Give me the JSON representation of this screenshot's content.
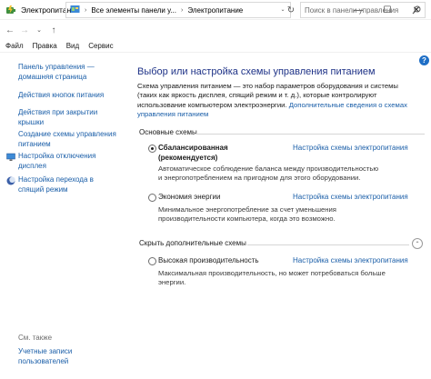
{
  "window": {
    "title": "Электропитание",
    "minimize": "—",
    "maximize": "☐",
    "close": "✕"
  },
  "address": {
    "back": "←",
    "forward": "→",
    "recent": "⌄",
    "up": "↑",
    "crumb_root": "›",
    "crumb_1": "Все элементы панели у...",
    "crumb_sep": "›",
    "crumb_2": "Электропитание",
    "dropdown": "⌄",
    "refresh": "↻",
    "search_placeholder": "Поиск в панели управления"
  },
  "menu": {
    "file": "Файл",
    "edit": "Правка",
    "view": "Вид",
    "service": "Сервис"
  },
  "help": "?",
  "sidebar": {
    "home_line1": "Панель управления —",
    "home_line2": "домашняя страница",
    "power_buttons": "Действия кнопок питания",
    "lid_line1": "Действия при закрытии",
    "lid_line2": "крышки",
    "create_line1": "Создание схемы управления",
    "create_line2": "питанием",
    "display_line1": "Настройка отключения",
    "display_line2": "дисплея",
    "sleep_line1": "Настройка перехода в",
    "sleep_line2": "спящий режим",
    "see_also": "См. также",
    "accounts_line1": "Учетные записи",
    "accounts_line2": "пользователей"
  },
  "main": {
    "heading": "Выбор или настройка схемы управления питанием",
    "intro_line1": "Схема управления питанием — это набор параметров оборудования и системы",
    "intro_line2": "(таких как яркость дисплея, спящий режим и т. д.), которые контролируют",
    "intro_line3a": "использование компьютером электроэнергии.",
    "intro_link_a": "Дополнительные сведения о схемах",
    "intro_link_b": "управления питанием",
    "main_plans_title": "Основные схемы",
    "balanced_line1": "Сбалансированная",
    "balanced_line2": "(рекомендуется)",
    "balanced_desc_line1": "Автоматическое соблюдение баланса между производительностью",
    "balanced_desc_line2": "и энергопотреблением на пригодном для этого оборудовании.",
    "saver_name": "Экономия энергии",
    "saver_desc_line1": "Минимальное энергопотребление за счет уменьшения",
    "saver_desc_line2": "производительности компьютера, когда это возможно.",
    "hide_title": "Скрыть дополнительные схемы",
    "collapse": "⌃",
    "high_name": "Высокая производительность",
    "high_desc_line1": "Максимальная производительность, но может потребоваться больше",
    "high_desc_line2": "энергии.",
    "plan_settings_link": "Настройка схемы электропитания"
  },
  "colors": {
    "link": "#1a5ea8",
    "heading": "#1e3287",
    "help_badge": "#1f6fc6"
  },
  "selected_plan": "balanced"
}
